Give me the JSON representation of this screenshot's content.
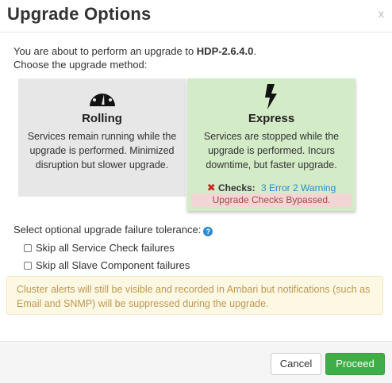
{
  "dialog": {
    "title": "Upgrade Options",
    "close_label": "x"
  },
  "intro": {
    "prefix": "You are about to perform an upgrade to ",
    "version": "HDP-2.6.4.0",
    "suffix": ".",
    "line2": "Choose the upgrade method:"
  },
  "methods": [
    {
      "name": "Rolling",
      "icon": "speedometer-icon",
      "desc": "Services remain running while the upgrade is performed. Minimized disruption but slower upgrade.",
      "selected": false
    },
    {
      "name": "Express",
      "icon": "lightning-bolt-icon",
      "desc": "Services are stopped while the upgrade is performed. Incurs downtime, but faster upgrade.",
      "selected": true,
      "checks_label": "Checks:",
      "checks_summary": "3 Error 2 Warning",
      "bypassed_text": "Upgrade Checks Bypassed."
    }
  ],
  "tolerance": {
    "label": "Select optional upgrade failure tolerance:",
    "options": [
      {
        "label": "Skip all Service Check failures",
        "checked": false
      },
      {
        "label": "Skip all Slave Component failures",
        "checked": false
      }
    ]
  },
  "alert": {
    "text": "Cluster alerts will still be visible and recorded in Ambari but notifications (such as Email and SNMP) will be suppressed during the upgrade."
  },
  "footer": {
    "cancel_label": "Cancel",
    "proceed_label": "Proceed"
  },
  "colors": {
    "selected_bg": "#d4ebc8",
    "unselected_bg": "#e7e7e7",
    "proceed_bg": "#3fae49",
    "link": "#2a8bd0",
    "alert_text": "#c09853"
  }
}
